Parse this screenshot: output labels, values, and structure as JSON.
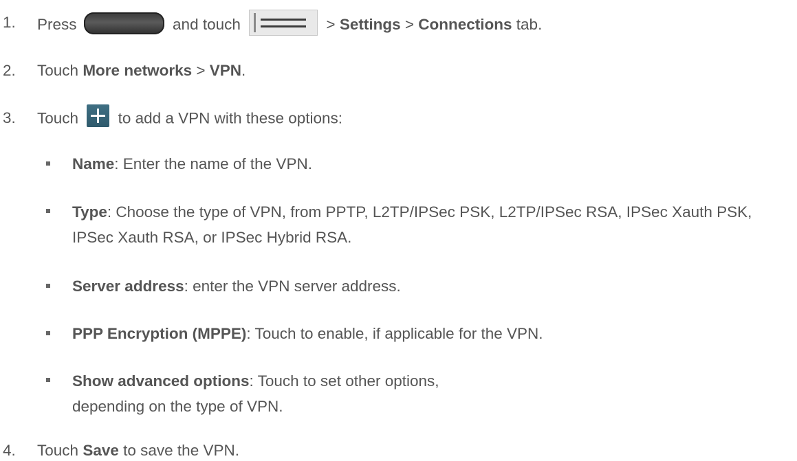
{
  "steps": [
    {
      "num": "1.",
      "t1": "Press",
      "t2": "and touch",
      "t3": ">",
      "b1": "Settings",
      "t4": ">",
      "b2": "Connections",
      "t5": "tab."
    },
    {
      "num": "2.",
      "t1": "Touch",
      "b1": "More networks",
      "t2": ">",
      "b2": "VPN",
      "t3": "."
    },
    {
      "num": "3.",
      "t1": "Touch",
      "t2": "to add a VPN with these options:"
    },
    {
      "num": "4.",
      "t1": "Touch",
      "b1": "Save",
      "t2": "to save the VPN."
    }
  ],
  "options": [
    {
      "term": "Name",
      "desc": ": Enter the name of the VPN."
    },
    {
      "term": "Type",
      "desc": ": Choose the type of VPN, from PPTP, L2TP/IPSec PSK, L2TP/IPSec RSA, IPSec Xauth PSK, IPSec Xauth RSA, or IPSec Hybrid RSA."
    },
    {
      "term": "Server address",
      "desc": ": enter the VPN server address."
    },
    {
      "term": "PPP Encryption (MPPE)",
      "desc": ": Touch to enable, if applicable for the VPN."
    },
    {
      "term": "Show advanced options",
      "desc": ": Touch to set other options, depending on the type of VPN."
    }
  ],
  "icons": {
    "home": "home-key-icon",
    "menu": "menu-key-icon",
    "add": "add-plus-icon"
  }
}
